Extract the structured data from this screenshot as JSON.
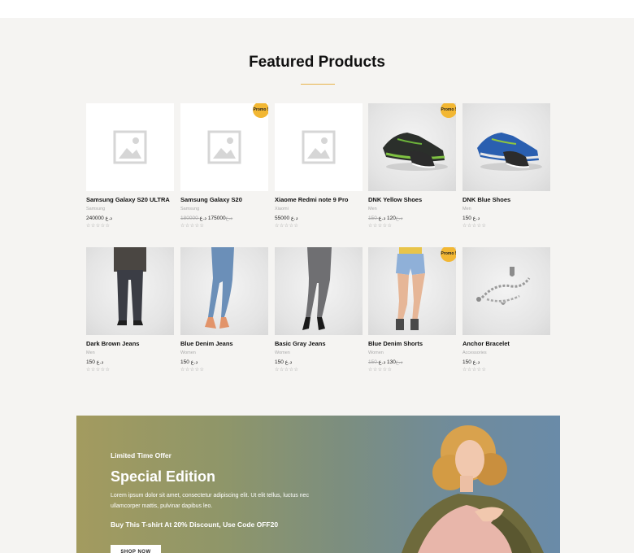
{
  "section": {
    "title": "Featured Products"
  },
  "products": [
    {
      "name": "Samsung Galaxy S20 ULTRA",
      "category": "Samsung",
      "old_price": "",
      "price": "240000 د.ع",
      "promo": "",
      "image": "placeholder-icon",
      "rating": "☆☆☆☆☆"
    },
    {
      "name": "Samsung Galaxy S20",
      "category": "Samsung",
      "old_price": "180000 د.ع",
      "price": "175000 د.ع",
      "promo": "Promo !",
      "image": "placeholder-icon",
      "rating": "☆☆☆☆☆"
    },
    {
      "name": "Xiaome Redmi note 9 Pro",
      "category": "Xiaomi",
      "old_price": "",
      "price": "55000 د.ع",
      "promo": "",
      "image": "placeholder-icon",
      "rating": "☆☆☆☆☆"
    },
    {
      "name": "DNK Yellow Shoes",
      "category": "Men",
      "old_price": "150 د.ع",
      "price": "120 د.ع",
      "promo": "Promo !",
      "image": "green-sneakers",
      "rating": "☆☆☆☆☆"
    },
    {
      "name": "DNK Blue Shoes",
      "category": "Men",
      "old_price": "",
      "price": "150 د.ع",
      "promo": "",
      "image": "blue-sneakers",
      "rating": "☆☆☆☆☆"
    },
    {
      "name": "Dark Brown Jeans",
      "category": "Men",
      "old_price": "",
      "price": "150 د.ع",
      "promo": "",
      "image": "mens-dark-jeans",
      "rating": "☆☆☆☆☆"
    },
    {
      "name": "Blue Denim Jeans",
      "category": "Women",
      "old_price": "",
      "price": "150 د.ع",
      "promo": "",
      "image": "womens-blue-jeans",
      "rating": "☆☆☆☆☆"
    },
    {
      "name": "Basic Gray Jeans",
      "category": "Women",
      "old_price": "",
      "price": "150 د.ع",
      "promo": "",
      "image": "womens-gray-jeans",
      "rating": "☆☆☆☆☆"
    },
    {
      "name": "Blue Denim Shorts",
      "category": "Women",
      "old_price": "150 د.ع",
      "price": "130 د.ع",
      "promo": "Promo !",
      "image": "denim-shorts",
      "rating": "☆☆☆☆☆"
    },
    {
      "name": "Anchor Bracelet",
      "category": "Accessories",
      "old_price": "",
      "price": "150 د.ع",
      "promo": "",
      "image": "silver-bracelet",
      "rating": "☆☆☆☆☆"
    }
  ],
  "banner": {
    "eyebrow": "Limited Time Offer",
    "headline": "Special Edition",
    "body": "Lorem ipsum dolor sit amet, consectetur adipiscing elit. Ut elit tellus, luctus nec ullamcorper mattis, pulvinar dapibus leo.",
    "promo_line": "Buy This T-shirt At 20% Discount, Use Code OFF20",
    "cta_label": "SHOP NOW"
  },
  "colors": {
    "accent": "#f2b733",
    "page_bg": "#f5f4f2"
  }
}
